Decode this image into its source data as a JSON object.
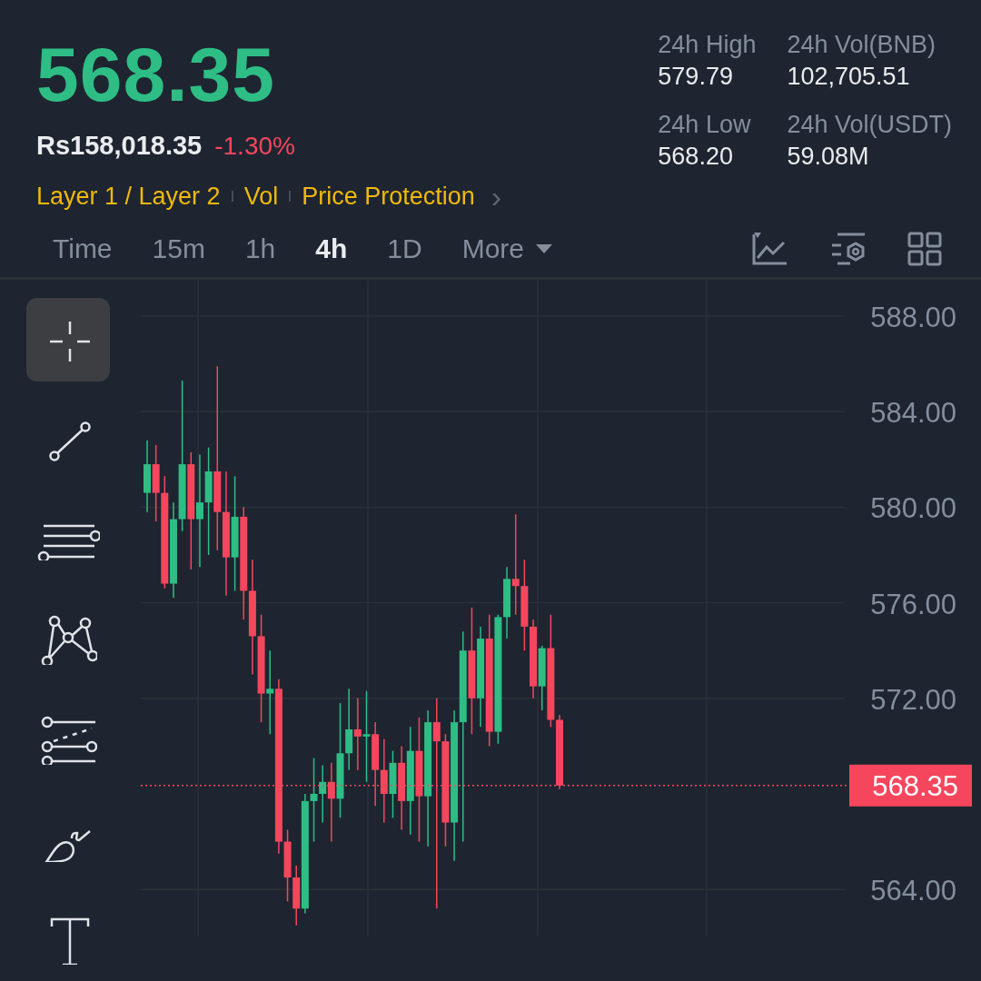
{
  "ticker": {
    "last_price": "568.35",
    "fiat_price": "Rs158,018.35",
    "change": "-1.30%",
    "tags": [
      "Layer 1 / Layer 2",
      "Vol",
      "Price Protection"
    ],
    "tags_chevron": "›"
  },
  "stats": [
    {
      "label": "24h High",
      "value": "579.79"
    },
    {
      "label": "24h Vol(BNB)",
      "value": "102,705.51"
    },
    {
      "label": "24h Low",
      "value": "568.20"
    },
    {
      "label": "24h Vol(USDT)",
      "value": "59.08M"
    }
  ],
  "intervals": [
    {
      "label": "Time",
      "selected": false
    },
    {
      "label": "15m",
      "selected": false
    },
    {
      "label": "1h",
      "selected": false
    },
    {
      "label": "4h",
      "selected": true
    },
    {
      "label": "1D",
      "selected": false
    },
    {
      "label": "More",
      "selected": false,
      "dropdown": true
    }
  ],
  "tools": [
    {
      "kind": "crosshair",
      "selected": true
    },
    {
      "kind": "line",
      "selected": false
    },
    {
      "kind": "parallel",
      "selected": false
    },
    {
      "kind": "pattern",
      "selected": false
    },
    {
      "kind": "fib",
      "selected": false
    },
    {
      "kind": "brush",
      "selected": false
    },
    {
      "kind": "text",
      "selected": false
    }
  ],
  "price_axis": {
    "labels": [
      "588.00",
      "584.00",
      "580.00",
      "576.00",
      "572.00",
      "564.00"
    ],
    "last_price_tag": "568.35"
  }
}
